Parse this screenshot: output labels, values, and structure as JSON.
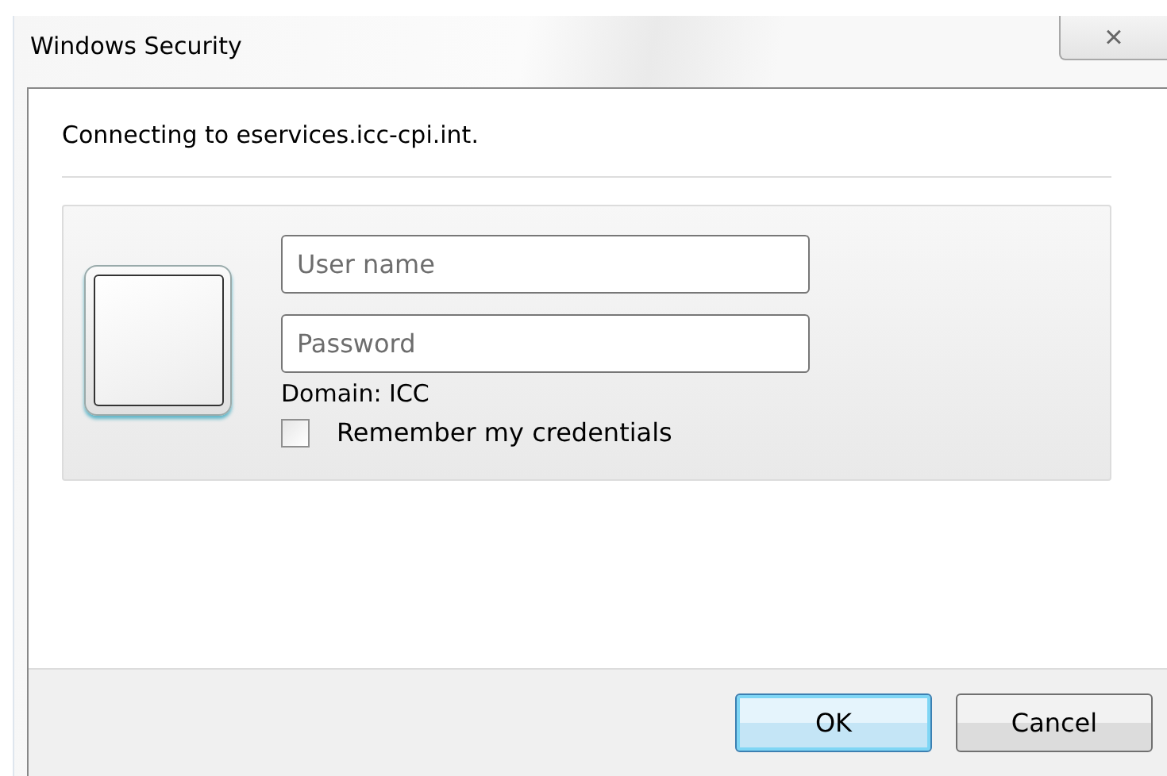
{
  "window": {
    "title": "Windows Security",
    "close": "×"
  },
  "message": "Connecting to eservices.icc-cpi.int.",
  "credentials": {
    "username": {
      "placeholder": "User name"
    },
    "password": {
      "placeholder": "Password"
    },
    "domain": "Domain: ICC",
    "remember": {
      "label": "Remember my credentials",
      "checked": false
    }
  },
  "buttons": [
    {
      "label": "OK",
      "default": true
    },
    {
      "label": "Cancel",
      "default": false
    }
  ]
}
